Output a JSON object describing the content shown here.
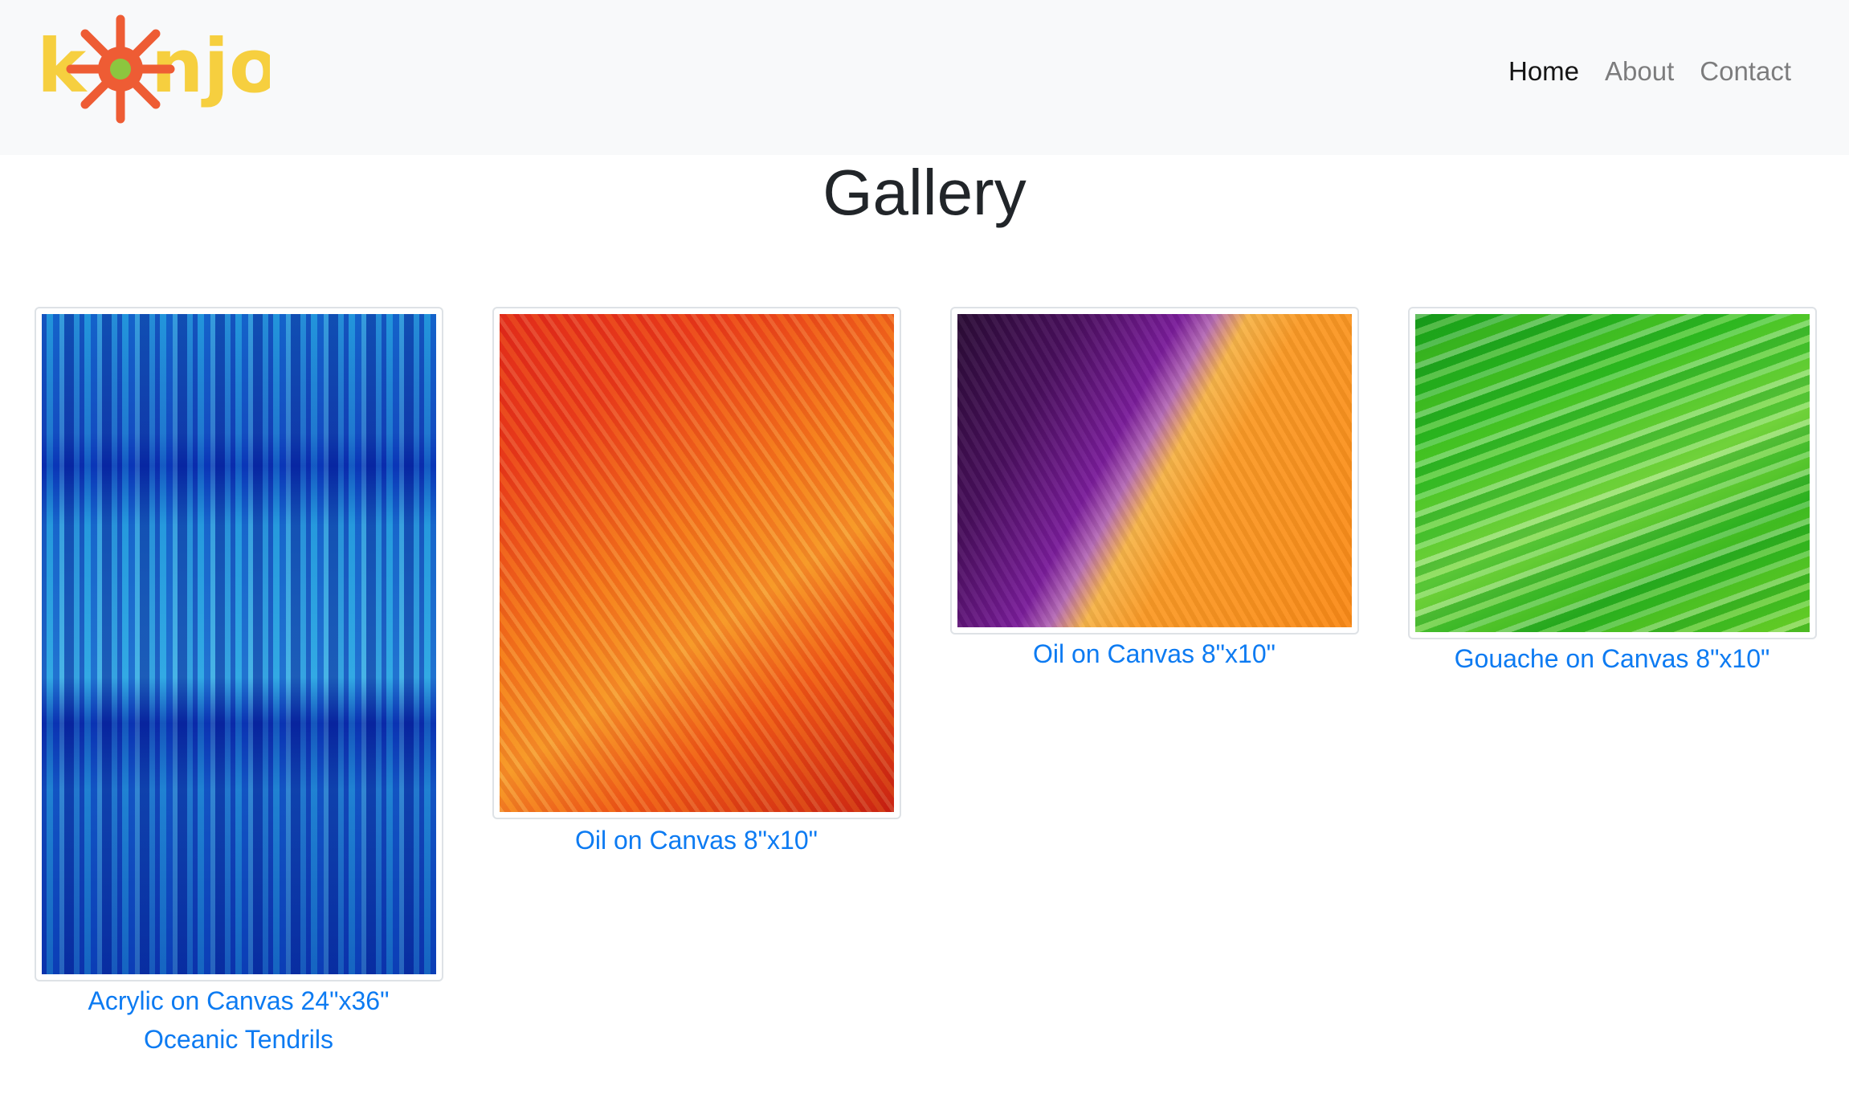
{
  "brand": {
    "logo_text": "konjo",
    "colors": {
      "letters": "#f6cf3f",
      "sun": "#ee5c34",
      "sun_center": "#8cc63f"
    }
  },
  "nav": {
    "items": [
      {
        "label": "Home",
        "active": true
      },
      {
        "label": "About",
        "active": false
      },
      {
        "label": "Contact",
        "active": false
      }
    ]
  },
  "page": {
    "title": "Gallery"
  },
  "gallery": {
    "items": [
      {
        "caption": "Acrylic on Canvas 24\"x36\"",
        "subtitle": "Oceanic Tendrils",
        "palette": "blue"
      },
      {
        "caption": "Oil on Canvas 8\"x10\"",
        "palette": "red-orange"
      },
      {
        "caption": "Oil on Canvas 8\"x10\"",
        "palette": "purple-orange"
      },
      {
        "caption": "Gouache on Canvas 8\"x10\"",
        "palette": "green"
      }
    ]
  },
  "colors": {
    "link": "#0d7bf2",
    "navbar_bg": "#f8f9fa",
    "card_border": "#dee2e6"
  }
}
